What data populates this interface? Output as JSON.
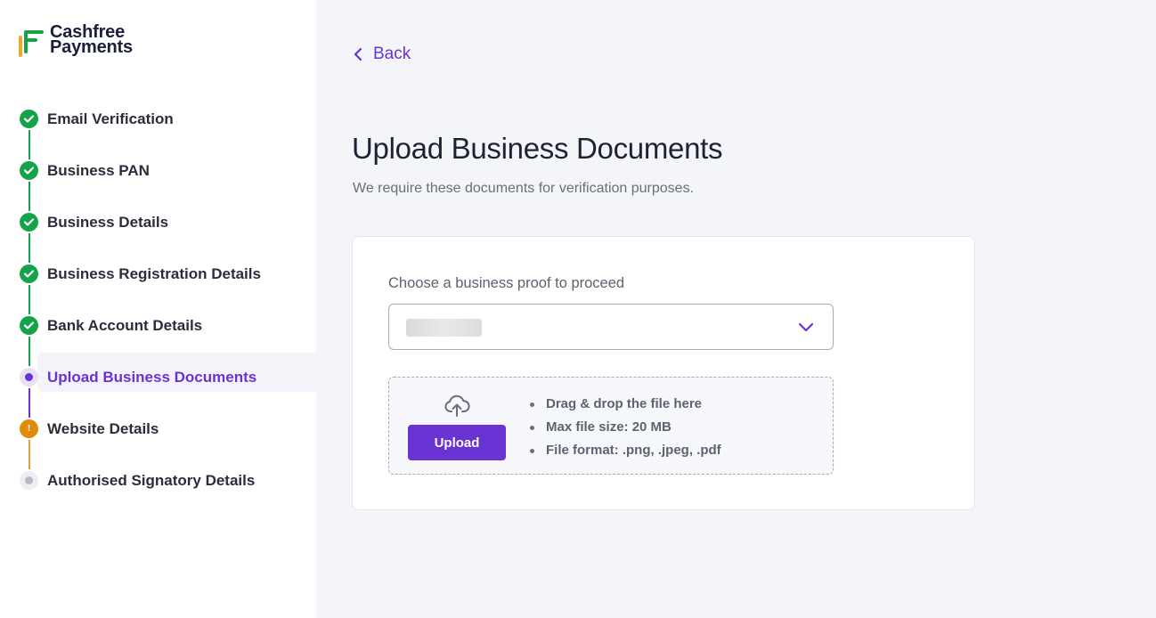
{
  "brand": {
    "line1": "Cashfree",
    "line2": "Payments"
  },
  "steps": [
    {
      "label": "Email Verification",
      "status": "done"
    },
    {
      "label": "Business PAN",
      "status": "done"
    },
    {
      "label": "Business Details",
      "status": "done"
    },
    {
      "label": "Business Registration Details",
      "status": "done"
    },
    {
      "label": "Bank Account Details",
      "status": "done"
    },
    {
      "label": "Upload Business Documents",
      "status": "current"
    },
    {
      "label": "Website Details",
      "status": "warning",
      "badge": "!"
    },
    {
      "label": "Authorised Signatory Details",
      "status": "pending"
    }
  ],
  "main": {
    "back_label": "Back",
    "title": "Upload Business Documents",
    "subtitle": "We require these documents for verification purposes.",
    "select_label": "Choose a business proof to proceed",
    "upload_label": "Upload",
    "rules": [
      "Drag & drop the file here",
      "Max file size: 20 MB",
      "File format: .png, .jpeg, .pdf"
    ]
  },
  "colors": {
    "accent": "#6933d3",
    "done": "#14a34a",
    "warning": "#e28a0b",
    "pending": "#b7b9c2"
  }
}
